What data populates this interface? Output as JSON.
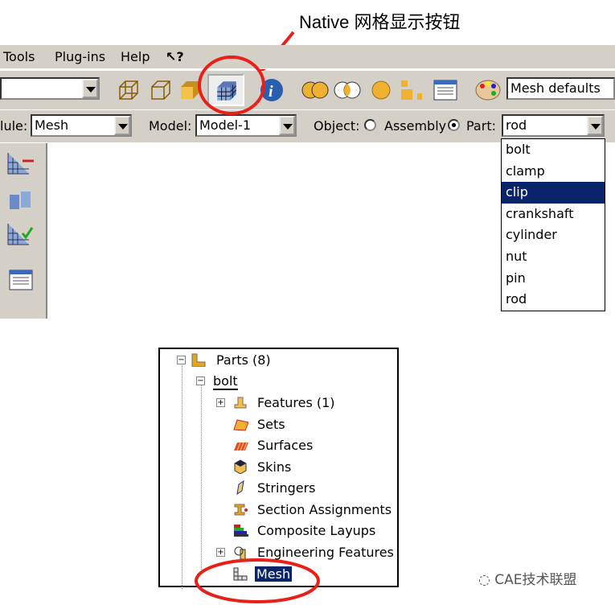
{
  "annotation": "Native 网格显示按钮",
  "menubar": {
    "items": [
      "Tools",
      "Plug-ins",
      "Help",
      "↖?"
    ]
  },
  "toolbar": {
    "render_style": "Mesh defaults",
    "icons": [
      "wireframe-icon",
      "hidden-line-icon",
      "shaded-icon",
      "native-mesh-display-icon",
      "info-icon",
      "boolean-union-icon",
      "boolean-intersect-icon",
      "sphere-icon",
      "part-tree-icon",
      "table-icon",
      "color-palette-icon"
    ]
  },
  "context": {
    "module_label": "lule:",
    "module_value": "Mesh",
    "model_label": "Model:",
    "model_value": "Model-1",
    "object_label": "Object:",
    "assembly_label": "Assembly",
    "part_label": "Part:",
    "part_value": "rod",
    "object_selected": "Part"
  },
  "part_dropdown": {
    "options": [
      "bolt",
      "clamp",
      "clip",
      "crankshaft",
      "cylinder",
      "nut",
      "pin",
      "rod"
    ],
    "highlighted": "clip"
  },
  "tree": {
    "root": "Parts (8)",
    "part": "bolt",
    "items": [
      "Features (1)",
      "Sets",
      "Surfaces",
      "Skins",
      "Stringers",
      "Section Assignments",
      "Composite Layups",
      "Engineering Features",
      "Mesh"
    ],
    "selected": "Mesh"
  },
  "watermark": "CAE技术联盟",
  "colors": {
    "highlight": "#0a246a",
    "annotation": "#e8201a",
    "chrome": "#d4d0c8"
  }
}
